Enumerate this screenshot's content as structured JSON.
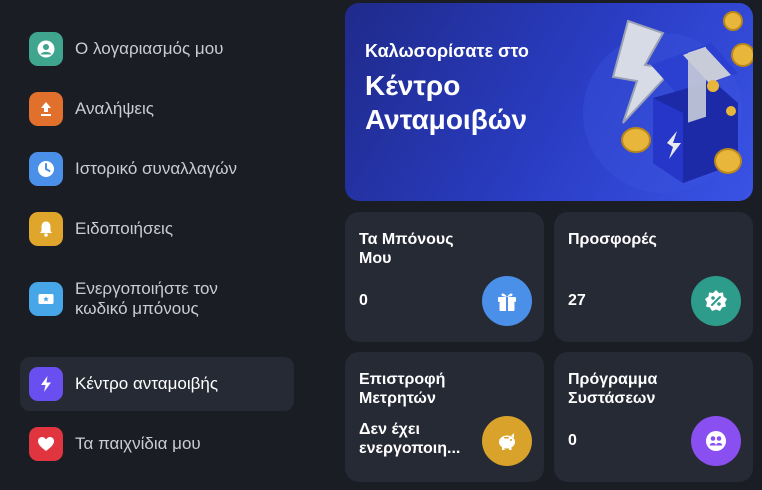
{
  "sidebar": {
    "items": [
      {
        "label": "Ο λογαριασμός μου",
        "icon": "user-icon",
        "color": "#3fa58f",
        "active": false
      },
      {
        "label": "Αναλήψεις",
        "icon": "upload-icon",
        "color": "#e0702b",
        "active": false
      },
      {
        "label": "Ιστορικό συναλλαγών",
        "icon": "clock-icon",
        "color": "#4a8fe8",
        "active": false
      },
      {
        "label": "Ειδοποιήσεις",
        "icon": "bell-icon",
        "color": "#e0a52b",
        "active": false
      },
      {
        "label_line1": "Ενεργοποιήστε τον",
        "label_line2": "κωδικό μπόνους",
        "icon": "ticket-icon",
        "color": "#46a6e8",
        "active": false
      },
      {
        "label": "Κέντρο ανταμοιβής",
        "icon": "lightning-icon",
        "color": "#6a4ff0",
        "active": true
      },
      {
        "label": "Τα παιχνίδια μου",
        "icon": "heart-icon",
        "color": "#e0343e",
        "active": false
      }
    ]
  },
  "banner": {
    "subtitle": "Καλωσορίσατε στο",
    "title_line1": "Κέντρο",
    "title_line2": "Ανταμοιβών"
  },
  "cards": [
    {
      "title": "Τα Μπόνους Μου",
      "value": "0",
      "icon": "gift-icon",
      "color": "#4a8fe8"
    },
    {
      "title": "Προσφορές",
      "value": "27",
      "icon": "percent-badge-icon",
      "color": "#2e9c8a"
    },
    {
      "title_line1": "Επιστροφή",
      "title_line2": "Μετρητών",
      "value_line1": "Δεν έχει",
      "value_line2": "ενεργοποιη...",
      "icon": "piggy-bank-icon",
      "color": "#d9a22a"
    },
    {
      "title_line1": "Πρόγραμμα",
      "title_line2": "Συστάσεων",
      "value": "0",
      "icon": "referral-icon",
      "color": "#8a4ff0"
    }
  ]
}
